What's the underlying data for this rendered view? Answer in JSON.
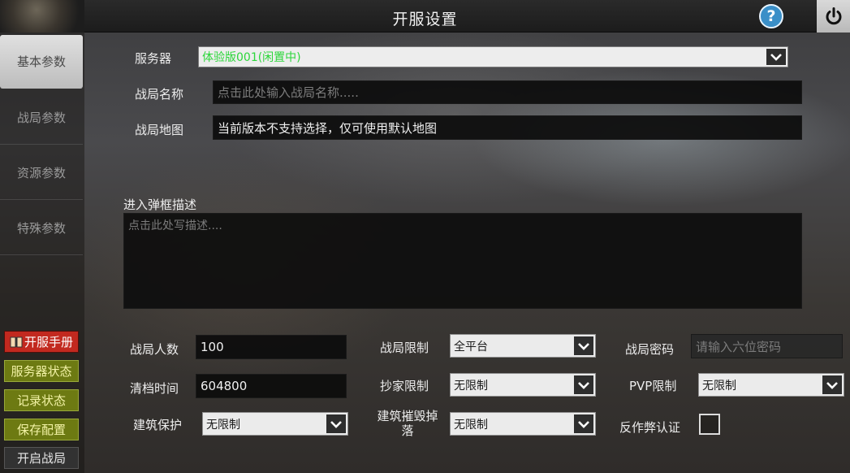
{
  "header": {
    "title": "开服设置",
    "help_icon_glyph": "?"
  },
  "sidebar": {
    "tabs": [
      {
        "label": "基本参数",
        "active": true
      },
      {
        "label": "战局参数",
        "active": false
      },
      {
        "label": "资源参数",
        "active": false
      },
      {
        "label": "特殊参数",
        "active": false
      }
    ],
    "buttons": {
      "manual": "开服手册",
      "server_status": "服务器状态",
      "record_status": "记录状态",
      "save_config": "保存配置",
      "start_game": "开启战局"
    }
  },
  "form": {
    "server": {
      "label": "服务器",
      "value": "体验版001(闲置中)",
      "value_color": "#2cd63a"
    },
    "match_name": {
      "label": "战局名称",
      "placeholder": "点击此处输入战局名称....."
    },
    "match_map": {
      "label": "战局地图",
      "value": "当前版本不支持选择，仅可使用默认地图"
    },
    "popup_desc": {
      "label": "进入弹框描述",
      "placeholder": "点击此处写描述...."
    },
    "player_count": {
      "label": "战局人数",
      "value": "100"
    },
    "match_limit": {
      "label": "战局限制",
      "value": "全平台"
    },
    "match_password": {
      "label": "战局密码",
      "placeholder": "请输入六位密码"
    },
    "wipe_time": {
      "label": "清档时间",
      "value": "604800"
    },
    "raid_limit": {
      "label": "抄家限制",
      "value": "无限制"
    },
    "pvp_limit": {
      "label": "PVP限制",
      "value": "无限制"
    },
    "building_protect": {
      "label": "建筑保护",
      "value": "无限制"
    },
    "building_destroy_drop": {
      "label_line1": "建筑摧毁掉",
      "label_line2": "落",
      "value": "无限制"
    },
    "anti_cheat": {
      "label": "反作弊认证",
      "checked": false
    }
  },
  "colors": {
    "accent_red": "#c2291f",
    "accent_olive": "#6d7a12",
    "help_blue": "#3a8fc8",
    "server_value_green": "#2cd63a"
  }
}
